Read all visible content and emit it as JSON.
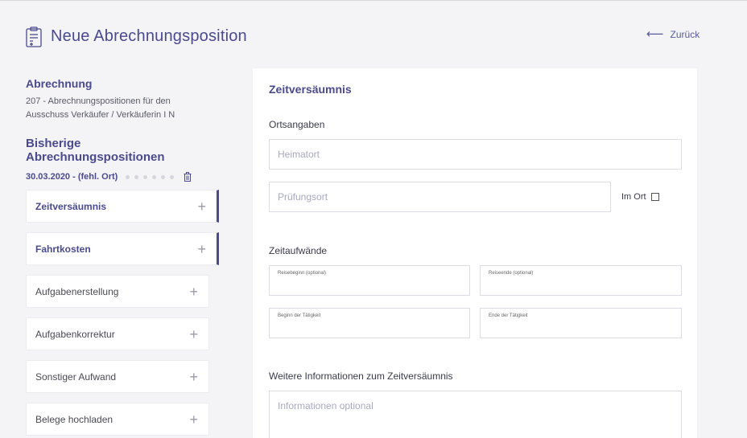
{
  "header": {
    "title": "Neue Abrechnungsposition",
    "back_label": "Zurück",
    "icon": "clipboard-add-icon"
  },
  "abrechnung": {
    "title": "Abrechnung",
    "description_line1": "207 - Abrechnungspositionen für den",
    "description_line2": "Ausschuss Verkäufer / Verkäuferin I N"
  },
  "bisherige": {
    "title": "Bisherige Abrechnungspositionen",
    "entry_label": "30.03.2020 - (fehl. Ort)"
  },
  "nav": {
    "items": [
      {
        "label": "Zeitversäumnis"
      },
      {
        "label": "Fahrtkosten"
      },
      {
        "label": "Aufgabenerstellung"
      },
      {
        "label": "Aufgabenkorrektur"
      },
      {
        "label": "Sonstiger Aufwand"
      },
      {
        "label": "Belege hochladen"
      }
    ],
    "plus": "+"
  },
  "form": {
    "title": "Zeitversäumnis",
    "ortsangaben_label": "Ortsangaben",
    "heimatort_placeholder": "Heimatort",
    "pruefungsort_placeholder": "Prüfungsort",
    "im_ort_label": "Im Ort",
    "zeitaufwaende_label": "Zeitaufwände",
    "reisebeginn_label": "Reisebeginn (optional)",
    "reiseende_label": "Reiseende (optional)",
    "beginn_label": "Beginn der Tätigkeit",
    "ende_label": "Ende der Tätigkeit",
    "weitere_label": "Weitere Informationen zum Zeitversäumnis",
    "informationen_placeholder": "Informationen optional"
  },
  "colors": {
    "accent": "#4a4a8c",
    "background": "#f4f4f7",
    "border": "#dcdce4"
  }
}
